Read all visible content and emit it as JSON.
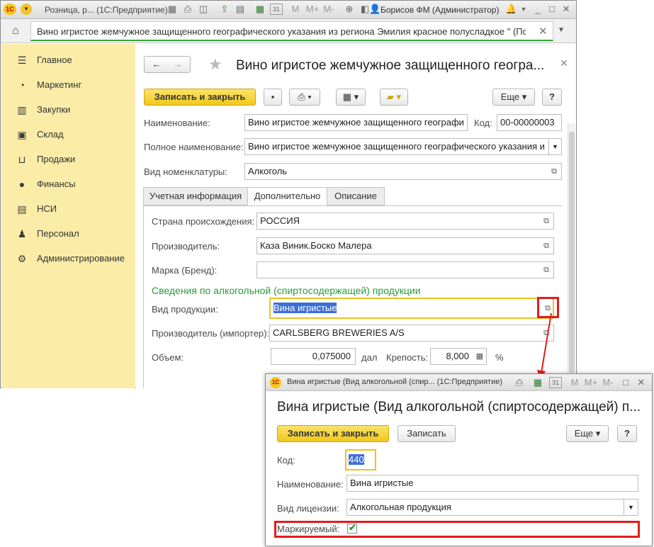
{
  "window": {
    "title": "Розница, р... (1С:Предприятие)",
    "user": "Борисов ФМ (Администратор)",
    "toolbar_letters": [
      "M",
      "M+",
      "M-"
    ],
    "calendar_day": "31"
  },
  "open_tab": {
    "title": "Вино игристое жемчужное защищенного географического указания из региона Эмилия красное полусладкое \" (По..."
  },
  "sidebar": {
    "items": [
      {
        "label": "Главное",
        "icon": "menu-icon"
      },
      {
        "label": "Маркетинг",
        "icon": "pie-chart-icon"
      },
      {
        "label": "Закупки",
        "icon": "cart-icon"
      },
      {
        "label": "Склад",
        "icon": "warehouse-icon"
      },
      {
        "label": "Продажи",
        "icon": "basket-icon"
      },
      {
        "label": "Финансы",
        "icon": "coin-icon"
      },
      {
        "label": "НСИ",
        "icon": "list-icon"
      },
      {
        "label": "Персонал",
        "icon": "person-icon"
      },
      {
        "label": "Администрирование",
        "icon": "gear-icon"
      }
    ]
  },
  "form": {
    "title": "Вино игристое жемчужное защищенного геогра...",
    "save_close_label": "Записать и закрыть",
    "more_label": "Еще",
    "help_label": "?",
    "name_label": "Наименование:",
    "name_value": "Вино игристое жемчужное защищенного географи",
    "code_label": "Код:",
    "code_value": "00-00000003",
    "full_name_label": "Полное наименование:",
    "full_name_value": "Вино игристое жемчужное защищенного географического указания и",
    "kind_label": "Вид номенклатуры:",
    "kind_value": "Алкоголь",
    "tabs": [
      {
        "label": "Учетная информация"
      },
      {
        "label": "Дополнительно"
      },
      {
        "label": "Описание"
      }
    ],
    "country_label": "Страна происхождения:",
    "country_value": "РОССИЯ",
    "manufacturer_label": "Производитель:",
    "manufacturer_value": "Каза Виник.Боско Малера",
    "brand_label": "Марка (Бренд):",
    "brand_value": "",
    "alcohol_section": "Сведения по алкогольной (спиртосодержащей) продукции",
    "product_kind_label": "Вид продукции:",
    "product_kind_value": "Вина игристые",
    "importer_label": "Производитель (импортер):",
    "importer_value": "CARLSBERG BREWERIES A/S",
    "volume_label": "Объем:",
    "volume_value": "0,075000",
    "volume_unit": "дал",
    "strength_label": "Крепость:",
    "strength_value": "8,000",
    "strength_unit": "%"
  },
  "popup": {
    "window_title": "Вина игристые (Вид алкогольной (спир...  (1С:Предприятие)",
    "heading": "Вина игристые (Вид алкогольной (спиртосодержащей) п...",
    "save_close_label": "Записать и закрыть",
    "save_label": "Записать",
    "more_label": "Еще",
    "help_label": "?",
    "code_label": "Код:",
    "code_value": "440",
    "name_label": "Наименование:",
    "name_value": "Вина игристые",
    "license_label": "Вид лицензии:",
    "license_value": "Алкогольная продукция",
    "marked_label": "Маркируемый:",
    "marked_checked": true
  },
  "colors": {
    "sidebar_bg": "#fbeca8",
    "accent_button": "#f1c81a",
    "highlight_red": "#e31b1b",
    "focus_yellow": "#f0c020",
    "section_green": "#2a9a3a"
  }
}
